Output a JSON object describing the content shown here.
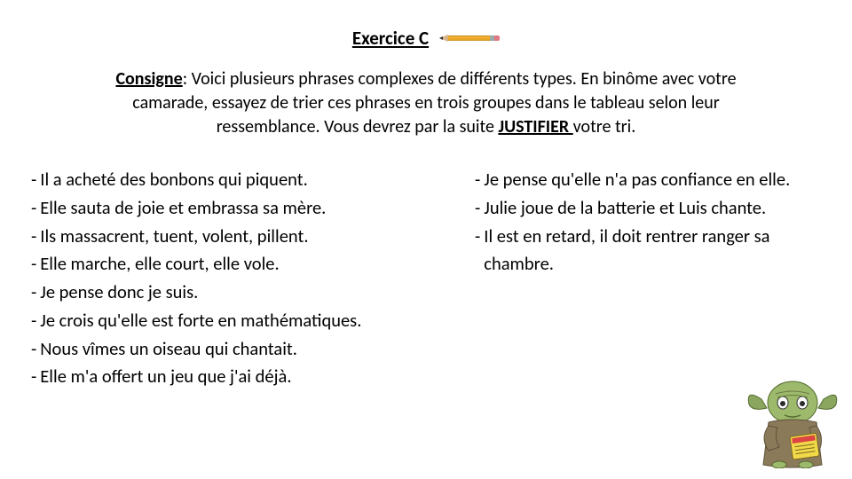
{
  "header": {
    "title": "Exercice C",
    "icon": "pencil-icon"
  },
  "consigne": {
    "label": "Consigne",
    "colon": ":",
    "text_before": "  Voici plusieurs phrases complexes de différents types. En binôme avec votre camarade, essayez de trier ces phrases en trois groupes dans le tableau selon leur ressemblance. Vous devrez par la suite ",
    "emphasis": "JUSTIFIER ",
    "text_after": "votre tri."
  },
  "left_column": [
    "Il a acheté des bonbons qui piquent.",
    "Elle sauta de joie et embrassa sa mère.",
    "Ils massacrent, tuent, volent, pillent.",
    "Elle marche, elle court, elle vole.",
    " Je pense donc je suis.",
    "Je crois qu'elle est forte en mathématiques.",
    "Nous vîmes un oiseau qui chantait.",
    "Elle m'a offert un jeu que j'ai déjà."
  ],
  "right_column": [
    " Je pense qu'elle n'a pas confiance en elle.",
    "Julie joue de la batterie et Luis chante.",
    " Il est en retard, il doit rentrer ranger sa chambre."
  ],
  "illustration": {
    "name": "yoda-reading-grammar-book"
  }
}
